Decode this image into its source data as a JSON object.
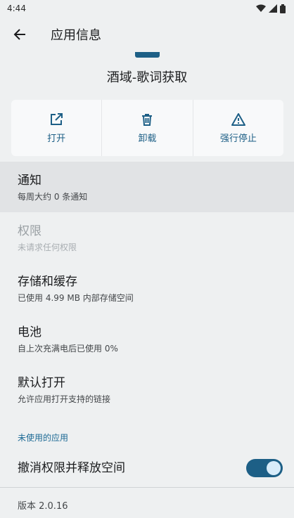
{
  "status_bar": {
    "time": "4:44",
    "icons": [
      "wifi-icon",
      "signal-icon",
      "battery-icon"
    ]
  },
  "app_bar": {
    "title": "应用信息"
  },
  "app": {
    "name": "酒域-歌词获取",
    "icon_color": "#1d5f86"
  },
  "actions": [
    {
      "label": "打开",
      "icon": "open-external-icon"
    },
    {
      "label": "卸载",
      "icon": "trash-icon"
    },
    {
      "label": "强行停止",
      "icon": "warning-icon"
    }
  ],
  "items": {
    "notifications": {
      "title": "通知",
      "summary": "每周大约 0 条通知"
    },
    "permissions": {
      "title": "权限",
      "summary": "未请求任何权限"
    },
    "storage": {
      "title": "存储和缓存",
      "summary": "已使用 4.99 MB 内部存储空间"
    },
    "battery": {
      "title": "电池",
      "summary": "自上次充满电后已使用 0%"
    },
    "open_by_default": {
      "title": "默认打开",
      "summary": "允许应用打开支持的链接"
    }
  },
  "unused_apps": {
    "header": "未使用的应用",
    "toggle_label": "撤消权限并释放空间",
    "toggle_on": true
  },
  "version": "版本 2.0.16",
  "colors": {
    "accent": "#1d5f86",
    "background": "#eef0f1"
  }
}
